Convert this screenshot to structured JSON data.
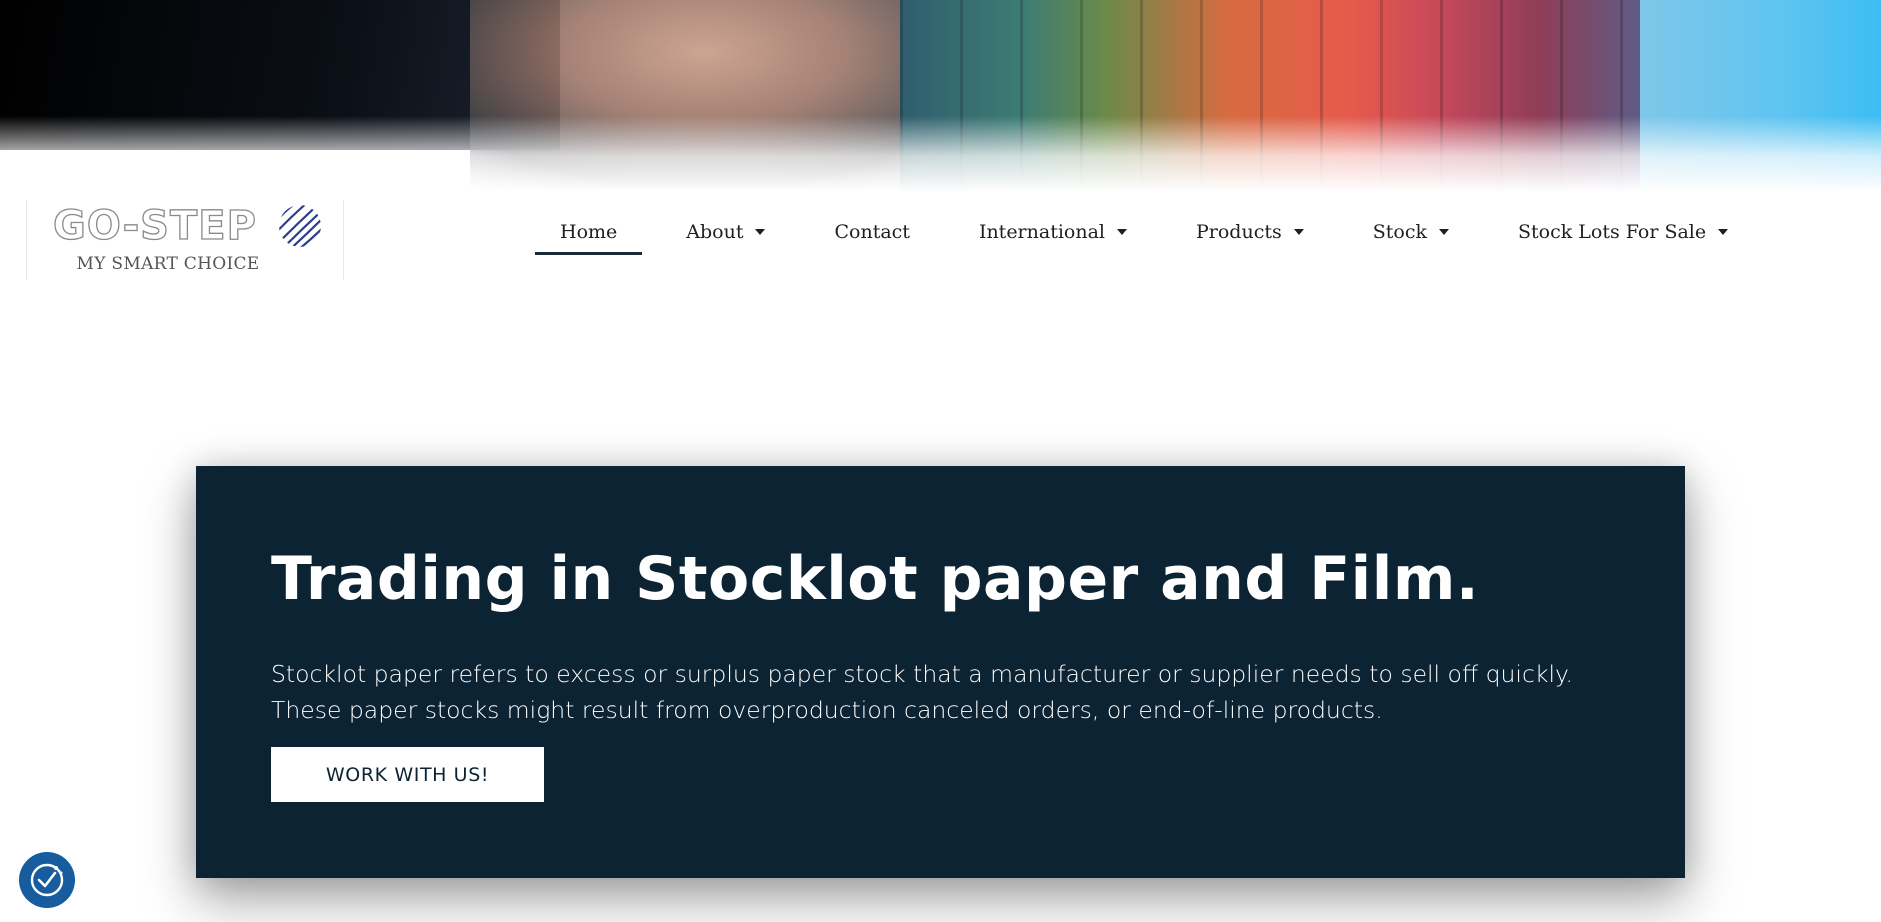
{
  "colors": {
    "card_background": "#0c2333",
    "nav_text": "#1f1f1f",
    "nav_active_underline": "#1b2a36",
    "consent_button": "#175c9e"
  },
  "hero": {
    "image": "shipping-containers-banner"
  },
  "logo": {
    "mark": "GO-STEP",
    "tagline": "MY SMART CHOICE",
    "icon": "globe-stripes-icon"
  },
  "nav": {
    "items": [
      {
        "label": "Home",
        "active": true,
        "dropdown": false
      },
      {
        "label": "About",
        "active": false,
        "dropdown": true
      },
      {
        "label": "Contact",
        "active": false,
        "dropdown": false
      },
      {
        "label": "International",
        "active": false,
        "dropdown": true
      },
      {
        "label": "Products",
        "active": false,
        "dropdown": true
      },
      {
        "label": "Stock",
        "active": false,
        "dropdown": true
      },
      {
        "label": "Stock Lots For Sale",
        "active": false,
        "dropdown": true
      }
    ]
  },
  "card": {
    "title": "Trading in Stocklot paper and Film.",
    "text_line1": "Stocklot paper refers to excess or surplus paper stock that a manufacturer or supplier needs to sell off quickly.",
    "text_line2": "These paper stocks might result from overproduction canceled orders, or end-of-line products.",
    "cta_label": "WORK WITH US!"
  },
  "consent": {
    "icon": "cookie-consent-icon"
  }
}
